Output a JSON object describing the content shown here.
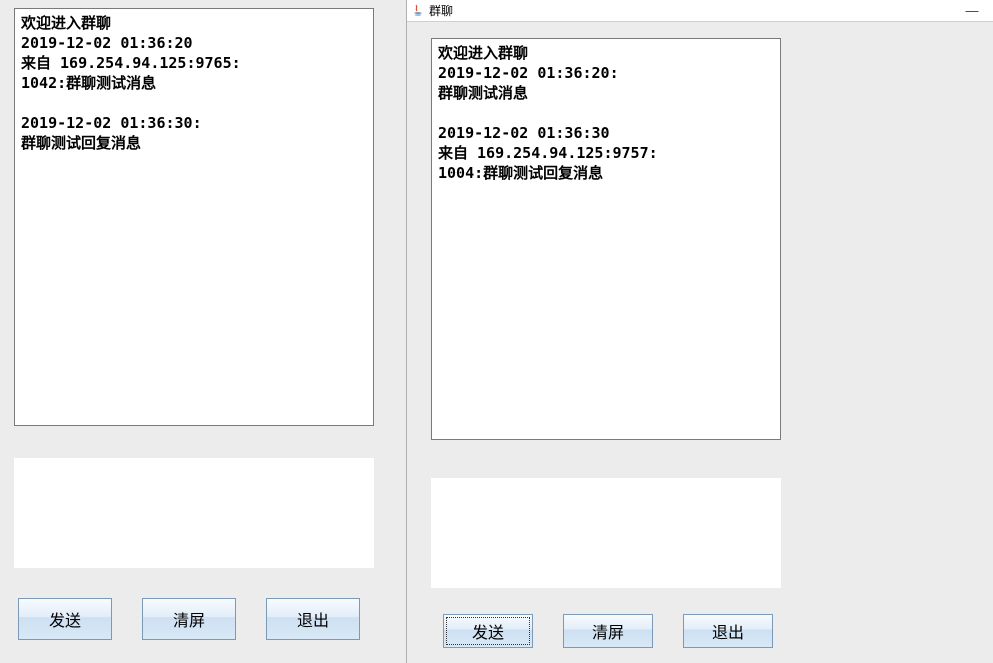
{
  "leftWindow": {
    "chatContent": "欢迎进入群聊\n2019-12-02 01:36:20\n来自 169.254.94.125:9765:\n1042:群聊测试消息\n\n2019-12-02 01:36:30:\n群聊测试回复消息",
    "inputValue": "",
    "buttons": {
      "send": "发送",
      "clear": "清屏",
      "exit": "退出"
    }
  },
  "rightWindow": {
    "title": "群聊",
    "chatContent": "欢迎进入群聊\n2019-12-02 01:36:20:\n群聊测试消息\n\n2019-12-02 01:36:30\n来自 169.254.94.125:9757:\n1004:群聊测试回复消息",
    "inputValue": "",
    "buttons": {
      "send": "发送",
      "clear": "清屏",
      "exit": "退出"
    }
  }
}
